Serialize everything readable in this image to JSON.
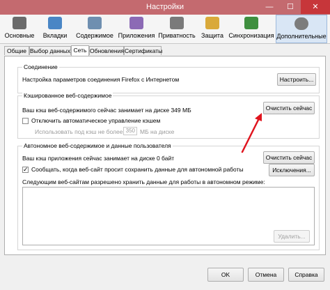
{
  "window": {
    "title": "Настройки",
    "minimize": "—",
    "maximize": "☐",
    "close": "✕"
  },
  "toolbar": [
    {
      "label": "Основные",
      "icon": "switch-icon",
      "color": "#6b6b6b"
    },
    {
      "label": "Вкладки",
      "icon": "tabs-icon",
      "color": "#4a86c5"
    },
    {
      "label": "Содержимое",
      "icon": "content-icon",
      "color": "#6f8fb0"
    },
    {
      "label": "Приложения",
      "icon": "applications-icon",
      "color": "#8c6ab5"
    },
    {
      "label": "Приватность",
      "icon": "mask-icon",
      "color": "#7a7a7a"
    },
    {
      "label": "Защита",
      "icon": "lock-icon",
      "color": "#d9a93a"
    },
    {
      "label": "Синхронизация",
      "icon": "sync-icon",
      "color": "#3f8f3f"
    },
    {
      "label": "Дополнительные",
      "icon": "gear-icon",
      "color": "#7c7c7c"
    }
  ],
  "tabs": [
    "Общие",
    "Выбор данных",
    "Сеть",
    "Обновления",
    "Сертификаты"
  ],
  "connection": {
    "title": "Соединение",
    "text": "Настройка параметров соединения Firefox с Интернетом",
    "button": "Настроить..."
  },
  "cache": {
    "title": "Кэшированное веб-содержимое",
    "text": "Ваш кэш веб-содержимого сейчас занимает на диске 349 МБ",
    "clear_button": "Очистить сейчас",
    "override_label": "Отключить автоматическое управление кэшем",
    "limit_prefix": "Использовать под кэш не более",
    "limit_value": "350",
    "limit_suffix": "МБ на диске"
  },
  "offline": {
    "title": "Автономное веб-содержимое и данные пользователя",
    "text": "Ваш кэш приложения сейчас занимает на диске 0 байт",
    "clear_button": "Очистить сейчас",
    "notify_label": "Сообщать, когда веб-сайт просит сохранить данные для автономной работы",
    "exceptions_button": "Исключения...",
    "list_label": "Следующим веб-сайтам разрешено хранить данные для работы в автономном режиме:",
    "remove_button": "Удалить..."
  },
  "dialog": {
    "ok": "OK",
    "cancel": "Отмена",
    "help": "Справка"
  },
  "colors": {
    "titlebar": "#c46a6f",
    "close": "#c7363a",
    "arrow": "#e0141e",
    "active_tool": "#d9e6f5"
  }
}
